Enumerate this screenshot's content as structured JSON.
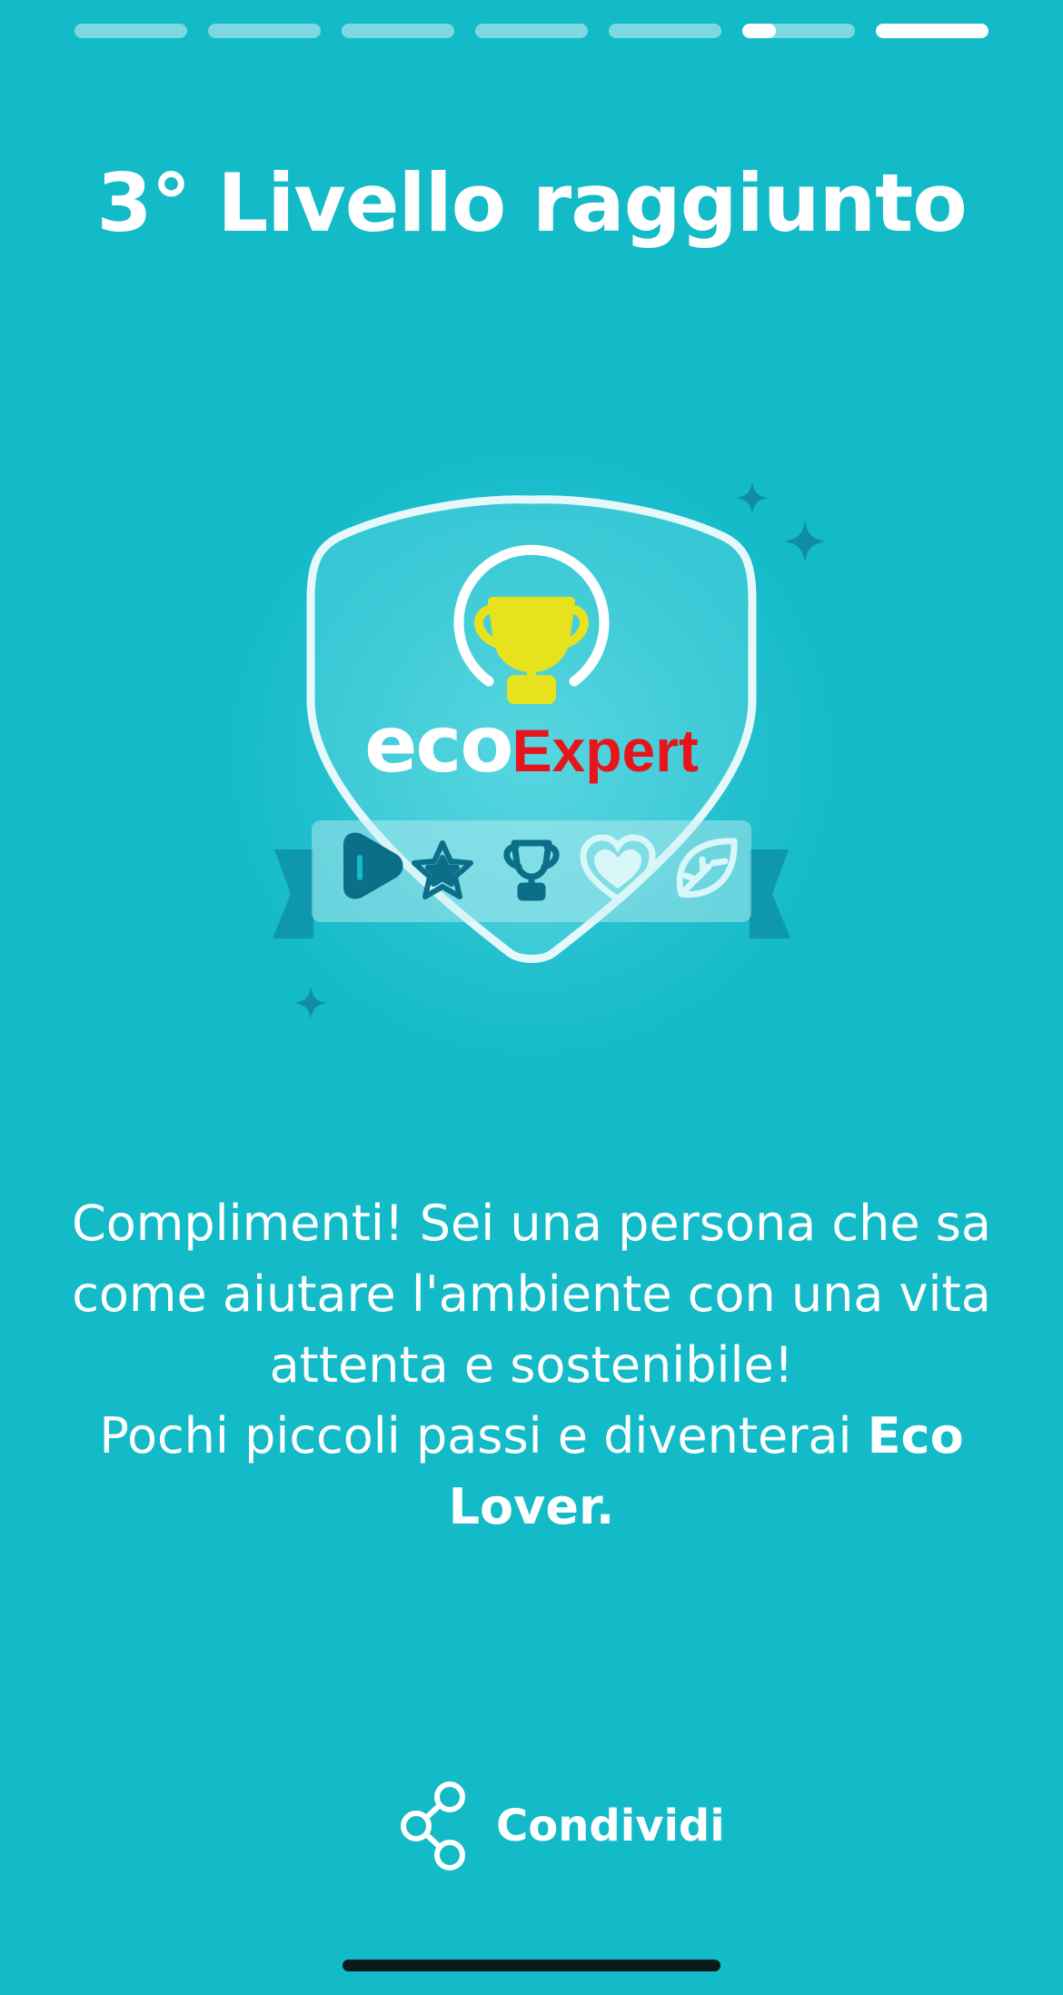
{
  "story_progress": {
    "segments": [
      {
        "filled": 0
      },
      {
        "filled": 0
      },
      {
        "filled": 0
      },
      {
        "filled": 0
      },
      {
        "filled": 0
      },
      {
        "filled": 0.3
      },
      {
        "filled": 1
      }
    ]
  },
  "title": "3° Livello raggiunto",
  "badge": {
    "brand_prefix": "eco",
    "brand_suffix": "Expert",
    "level_icons": [
      "play-icon",
      "star-icon",
      "trophy-icon",
      "heart-icon",
      "leaf-icon"
    ],
    "colors": {
      "background": "#13bac8",
      "expert_text": "#e8141c",
      "trophy": "#e6e21e",
      "achieved_icon": "#0c6f8a"
    }
  },
  "message": {
    "line1": "Complimenti! Sei una persona che sa come aiutare l'ambiente con una vita attenta e sostenibile!",
    "line2_prefix": "Pochi piccoli passi e diventerai ",
    "line2_bold": "Eco Lover."
  },
  "share": {
    "label": "Condividi",
    "icon": "share-icon"
  }
}
